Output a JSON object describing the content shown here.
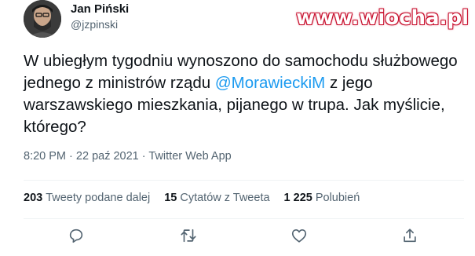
{
  "user": {
    "name": "Jan Piński",
    "handle": "@jzpinski"
  },
  "watermark": "www.wiocha.pl",
  "tweet": {
    "text_before": "W ubiegłym tygodniu wynoszono do samochodu służbowego jednego z ministrów rządu ",
    "mention": "@MorawieckiM",
    "text_after": " z jego warszawskiego mieszkania, pijanego w trupa. Jak myślicie, którego?"
  },
  "meta": {
    "time": "8:20 PM",
    "date": "22 paź 2021",
    "source": "Twitter Web App",
    "separator": "·"
  },
  "stats": {
    "retweets_count": "203",
    "retweets_label": "Tweety podane dalej",
    "quotes_count": "15",
    "quotes_label": "Cytatów z Tweeta",
    "likes_count": "1 225",
    "likes_label": "Polubień"
  },
  "icons": [
    "reply-icon",
    "retweet-icon",
    "like-icon",
    "share-icon"
  ],
  "colors": {
    "mention": "#1d9bf0",
    "secondary_text": "#536471",
    "primary_text": "#0f1419",
    "watermark_outline": "#c8102e"
  }
}
